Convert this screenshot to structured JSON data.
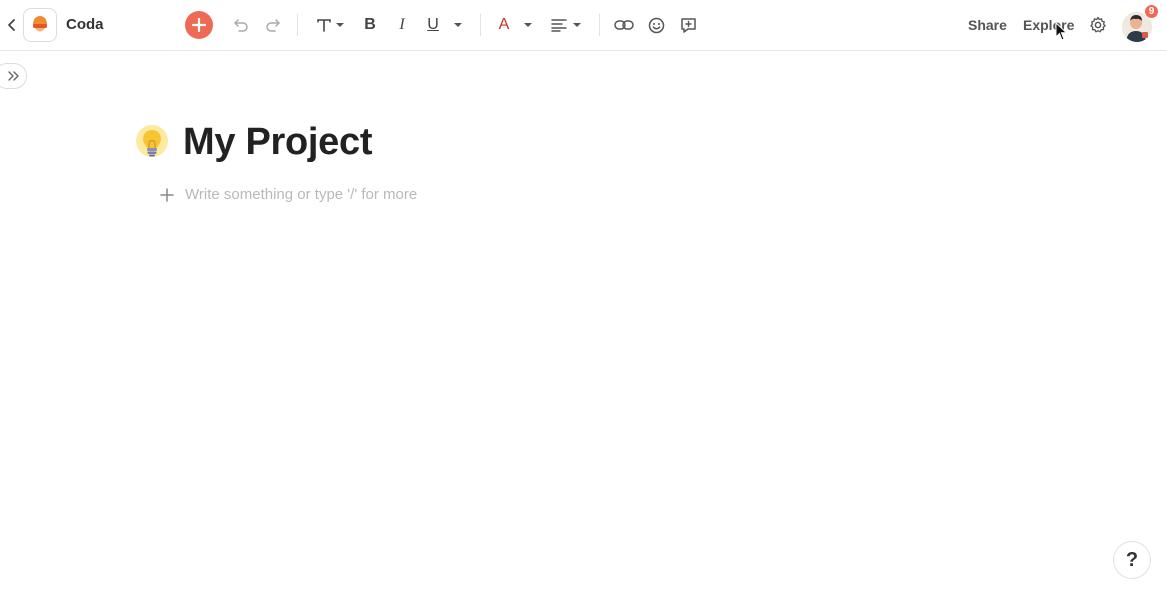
{
  "app": {
    "name": "Coda"
  },
  "toolbar": {
    "items": [
      {
        "name": "add",
        "icon": "plus-icon"
      },
      {
        "name": "undo",
        "icon": "undo-icon"
      },
      {
        "name": "redo",
        "icon": "redo-icon"
      },
      {
        "name": "text-style",
        "label": "T",
        "icon": "text-style-icon"
      },
      {
        "name": "bold",
        "label": "B",
        "icon": "bold-icon"
      },
      {
        "name": "italic",
        "label": "I",
        "icon": "italic-icon"
      },
      {
        "name": "underline",
        "label": "U",
        "icon": "underline-icon"
      },
      {
        "name": "text-color",
        "label": "A",
        "icon": "text-color-icon"
      },
      {
        "name": "align",
        "icon": "align-left-icon"
      },
      {
        "name": "link",
        "icon": "link-icon"
      },
      {
        "name": "emoji",
        "icon": "smiley-icon"
      },
      {
        "name": "comment",
        "icon": "add-comment-icon"
      }
    ],
    "text_color": "#c0392b",
    "add_color": "#ef6a55"
  },
  "header_right": {
    "share_label": "Share",
    "explore_label": "Explore",
    "notification_count": "9"
  },
  "doc": {
    "title": "My Project",
    "emoji": "light-bulb-icon",
    "placeholder": "Write something or type '/' for more"
  },
  "help": {
    "label": "?"
  }
}
